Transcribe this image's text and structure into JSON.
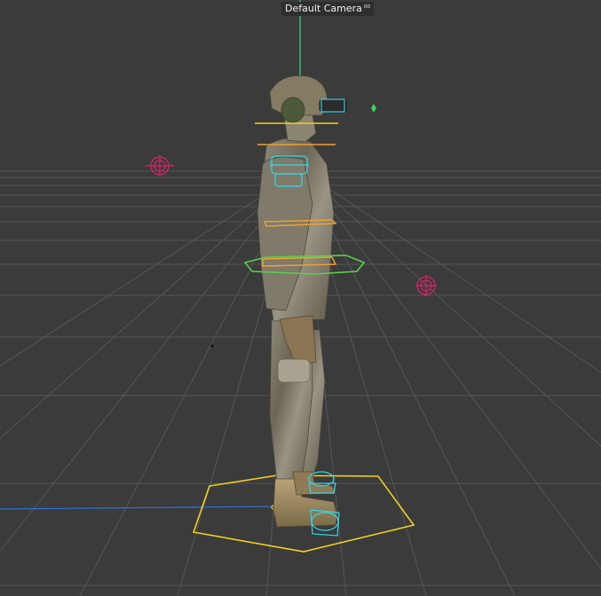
{
  "viewport": {
    "camera_name": "Default Camera",
    "camera_icon": "camera-orbit-icon",
    "colors": {
      "background": "#3b3b3b",
      "grid": "#5a5a5a",
      "y_axis": "#37d68a",
      "x_axis": "#2f6fd6",
      "joint_control": "#33d6e6",
      "foot_roll_control": "#f0d020",
      "chest_control": "#f0a030",
      "hip_control": "#58d24a",
      "target_locator": "#e0206a",
      "locator_small": "#39d45a"
    }
  }
}
